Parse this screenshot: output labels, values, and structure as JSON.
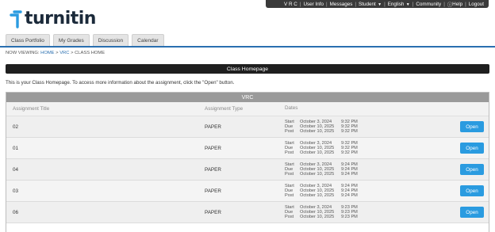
{
  "topbar": {
    "user": "V R C",
    "links": [
      "User Info",
      "Messages"
    ],
    "role": "Student",
    "language": "English",
    "community": "Community",
    "help": "Help",
    "logout": "Logout"
  },
  "logo": {
    "text": "turnitin"
  },
  "tabs": [
    {
      "label": "Class Portfolio"
    },
    {
      "label": "My Grades"
    },
    {
      "label": "Discussion"
    },
    {
      "label": "Calendar"
    }
  ],
  "breadcrumb": {
    "prefix": "NOW VIEWING:",
    "home": "HOME",
    "class": "VRC",
    "current": "CLASS HOME"
  },
  "page_header": "Class Homepage",
  "intro": "This is your Class Homepage. To access more information about the assignment, click the \"Open\" button.",
  "class_name": "VRC",
  "columns": {
    "title": "Assignment Title",
    "type": "Assignment Type",
    "dates": "Dates"
  },
  "date_labels": {
    "start": "Start",
    "due": "Due",
    "post": "Post"
  },
  "open_label": "Open",
  "assignments": [
    {
      "title": "02",
      "type": "PAPER",
      "start": "October 3, 2024",
      "start_time": "9:32 PM",
      "due": "October 10, 2025",
      "due_time": "9:32 PM",
      "post": "October 10, 2025",
      "post_time": "9:32 PM"
    },
    {
      "title": "01",
      "type": "PAPER",
      "start": "October 3, 2024",
      "start_time": "9:32 PM",
      "due": "October 10, 2025",
      "due_time": "9:32 PM",
      "post": "October 10, 2025",
      "post_time": "9:32 PM"
    },
    {
      "title": "04",
      "type": "PAPER",
      "start": "October 3, 2024",
      "start_time": "9:24 PM",
      "due": "October 10, 2025",
      "due_time": "9:24 PM",
      "post": "October 10, 2025",
      "post_time": "9:24 PM"
    },
    {
      "title": "03",
      "type": "PAPER",
      "start": "October 3, 2024",
      "start_time": "9:24 PM",
      "due": "October 10, 2025",
      "due_time": "9:24 PM",
      "post": "October 10, 2025",
      "post_time": "9:24 PM"
    },
    {
      "title": "06",
      "type": "PAPER",
      "start": "October 3, 2024",
      "start_time": "9:23 PM",
      "due": "October 10, 2025",
      "due_time": "9:23 PM",
      "post": "October 10, 2025",
      "post_time": "9:23 PM"
    }
  ],
  "colors": {
    "accent": "#2a9be0",
    "header": "#1f1f1f",
    "tab_line": "#2a6fb0"
  }
}
